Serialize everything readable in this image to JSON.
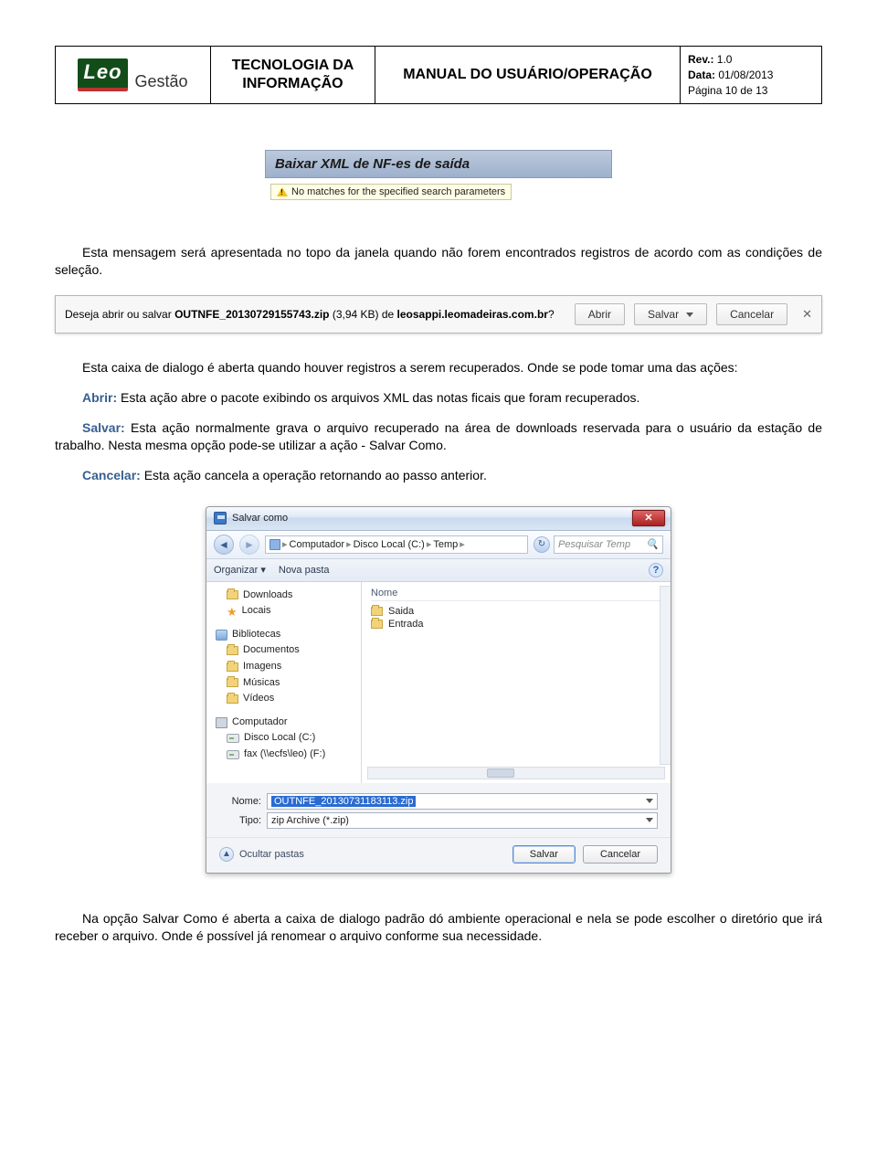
{
  "header": {
    "logo_brand": "Leo",
    "logo_sub": "Gestão",
    "dept_l1": "TECNOLOGIA DA",
    "dept_l2": "INFORMAÇÃO",
    "manual_title": "MANUAL DO USUÁRIO/OPERAÇÃO",
    "rev_label": "Rev.:",
    "rev_value": "1.0",
    "date_label": "Data:",
    "date_value": "01/08/2013",
    "page_label": "Página",
    "page_current": "10",
    "page_of": "de",
    "page_total": "13"
  },
  "shot1": {
    "bar_text": "Baixar XML de NF-es de saída",
    "msg": "No matches for the specified search parameters"
  },
  "para1": "Esta mensagem será apresentada no topo da janela quando não forem encontrados registros de acordo com as condições de seleção.",
  "iebar": {
    "q1": "Deseja abrir ou salvar ",
    "fname": "OUTNFE_20130729155743.zip",
    "size": " (3,94 KB) de ",
    "host": "leosappi.leomadeiras.com.br",
    "qend": "?",
    "btn_open": "Abrir",
    "btn_save": "Salvar",
    "btn_cancel": "Cancelar"
  },
  "para2": "Esta caixa de dialogo é aberta quando houver registros a serem recuperados. Onde se pode tomar uma das ações:",
  "def_abrir": {
    "term": "Abrir:",
    "text": " Esta ação abre o pacote exibindo os arquivos XML das notas ficais que foram recuperados."
  },
  "def_salvar": {
    "term": "Salvar:",
    "text": " Esta ação normalmente grava o arquivo recuperado na área de downloads reservada para o usuário da estação de trabalho. Nesta mesma opção pode-se utilizar a ação - Salvar Como."
  },
  "def_cancelar": {
    "term": "Cancelar:",
    "text": " Esta ação cancela a operação retornando ao passo anterior."
  },
  "dlg": {
    "title": "Salvar como",
    "crumb1": "Computador",
    "crumb2": "Disco Local (C:)",
    "crumb3": "Temp",
    "search_placeholder": "Pesquisar Temp",
    "tool_org": "Organizar ▾",
    "tool_new": "Nova pasta",
    "tree": {
      "downloads": "Downloads",
      "locais": "Locais",
      "bib": "Bibliotecas",
      "docs": "Documentos",
      "imagens": "Imagens",
      "musicas": "Músicas",
      "videos": "Vídeos",
      "computador": "Computador",
      "disco": "Disco Local (C:)",
      "fax": "fax (\\\\ecfs\\leo) (F:)"
    },
    "files_hdr": "Nome",
    "files": {
      "saida": "Saida",
      "entrada": "Entrada"
    },
    "nome_label": "Nome:",
    "nome_value": "OUTNFE_20130731183113.zip",
    "tipo_label": "Tipo:",
    "tipo_value": "zip Archive (*.zip)",
    "hide_folders": "Ocultar pastas",
    "btn_save": "Salvar",
    "btn_cancel": "Cancelar"
  },
  "para3": "Na opção Salvar Como é aberta a caixa de dialogo padrão dó ambiente operacional e nela se pode escolher o diretório que irá receber o arquivo. Onde é possível já renomear o arquivo conforme sua necessidade."
}
